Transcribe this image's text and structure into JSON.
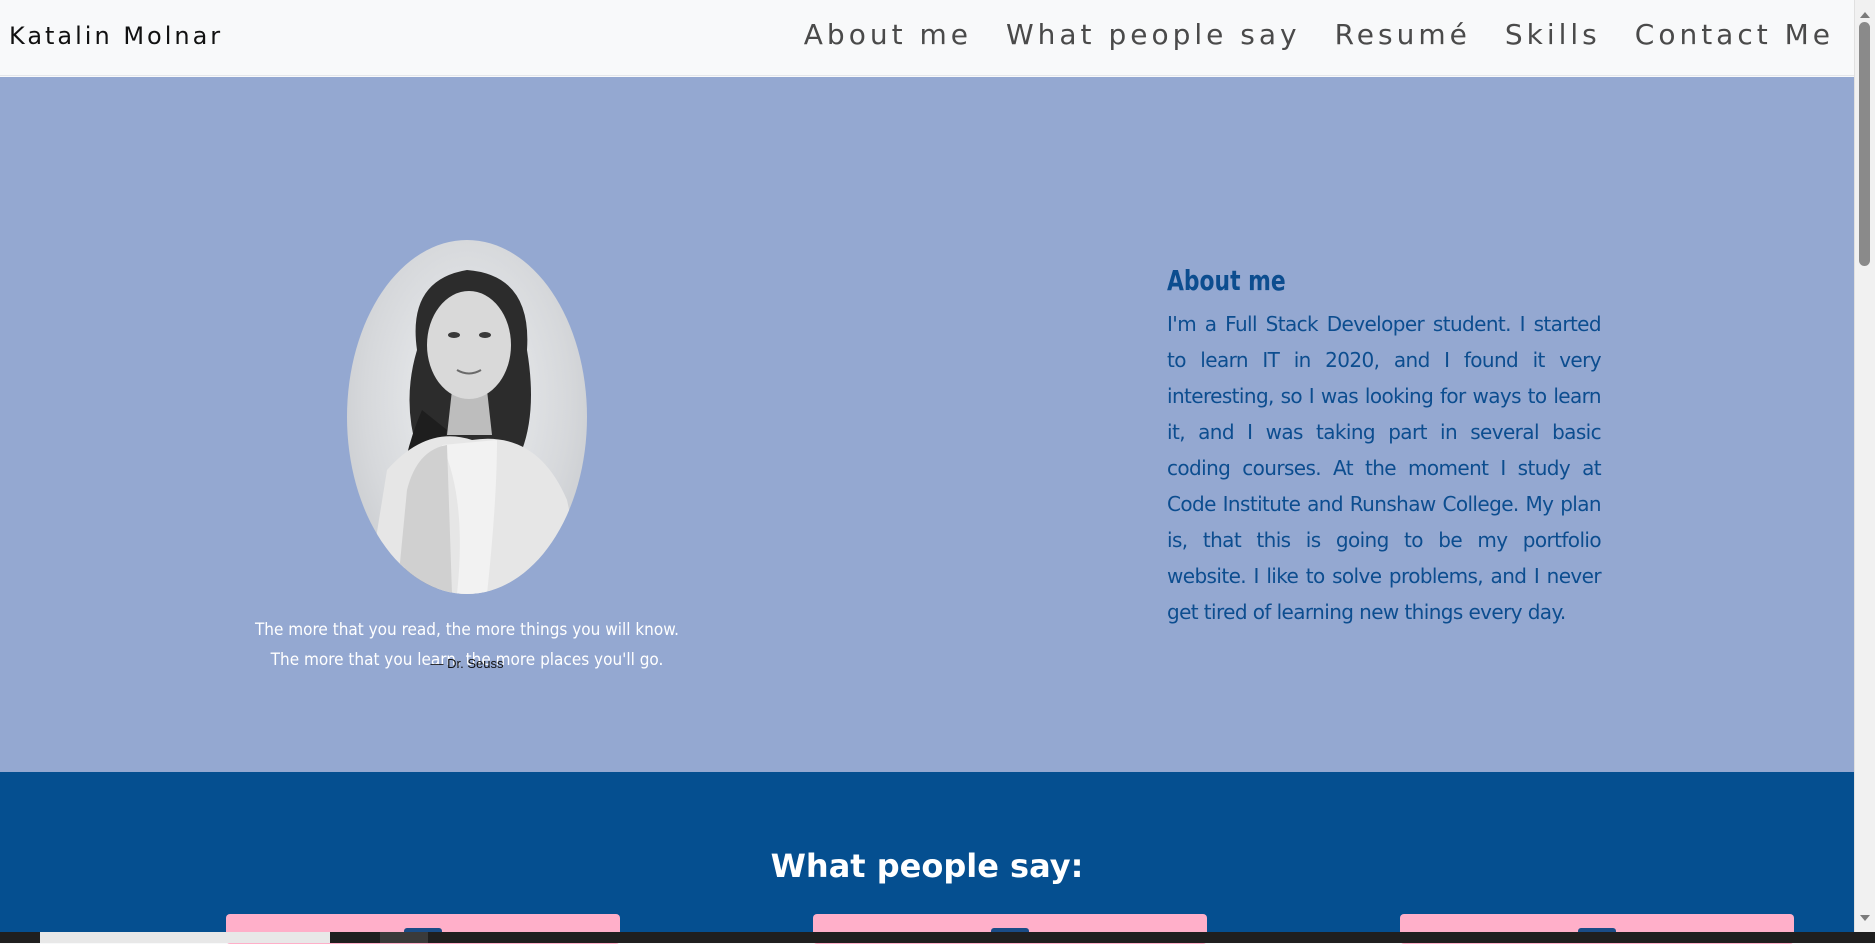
{
  "navbar": {
    "brand": "Katalin Molnar",
    "links": [
      "About me",
      "What people say",
      "Resumé",
      "Skills",
      "Contact Me"
    ]
  },
  "about": {
    "quote": "The more that you read, the more things you will know. The more that you learn, the more places you'll go.",
    "quote_author": "—  Dr. Seuss",
    "title": "About me",
    "text": "I'm a Full Stack Developer student. I started to learn IT in 2020, and I found it very interesting, so I was looking for ways to learn it, and I was taking part in several basic coding courses. At the moment I study at Code Institute and Runshaw College. My plan is, that this is going to be my portfolio website. I like to solve problems, and I never get tired of learning new things every day."
  },
  "people": {
    "title": "What people say:"
  },
  "colors": {
    "about_bg": "#94a8d1",
    "people_bg": "#054f90",
    "card_bg": "#ffafc9",
    "accent_text": "#0c4d8f"
  }
}
